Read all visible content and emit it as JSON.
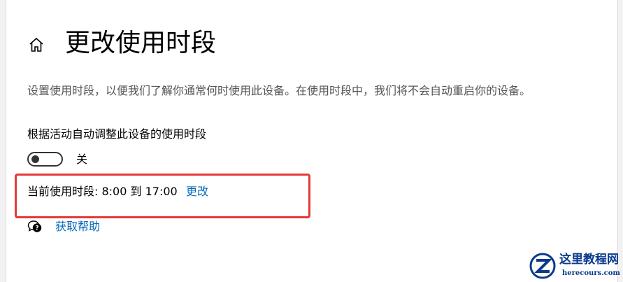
{
  "header": {
    "icon": "home-icon",
    "title": "更改使用时段"
  },
  "description": "设置使用时段，以便我们了解你通常何时使用此设备。在使用时段中，我们将不会自动重启你的设备。",
  "auto_adjust": {
    "label": "根据活动自动调整此设备的使用时段",
    "toggle_on": false,
    "state_text": "关"
  },
  "active_hours": {
    "text": "当前使用时段: 8:00 到 17:00",
    "change_link": "更改"
  },
  "help": {
    "icon": "help-chat-icon",
    "link": "获取帮助"
  },
  "watermark": {
    "title": "这里教程网",
    "url": "herecours.com"
  },
  "colors": {
    "link": "#0067b8",
    "highlight": "#e53935",
    "description_text": "#555555",
    "watermark": "#0a3a8c"
  }
}
